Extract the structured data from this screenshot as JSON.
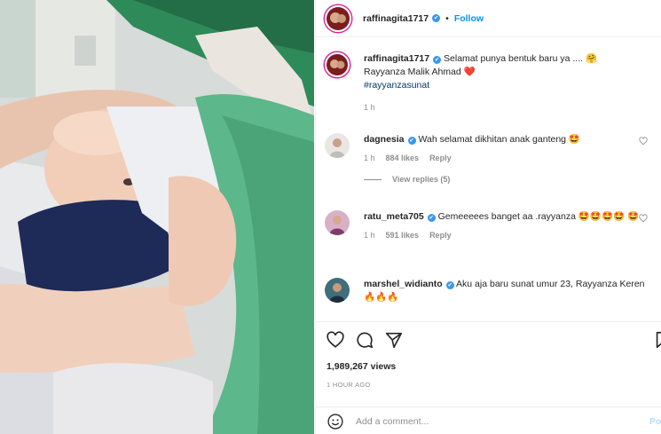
{
  "post": {
    "username": "raffinagita1717",
    "follow_label": "Follow",
    "dot": "•",
    "more_label": "···",
    "caption_line1": "Selamat punya bentuk baru ya .... 🤗",
    "caption_line2": "Rayyanza Malik Ahmad ❤️",
    "hashtag": "#rayyanzasunat",
    "caption_time": "1 h"
  },
  "comments": [
    {
      "username": "dagnesia",
      "text": "Wah selamat dikhitan anak ganteng 🤩",
      "time": "1 h",
      "likes": "884 likes",
      "reply": "Reply",
      "view_replies": "View replies (5)"
    },
    {
      "username": "ratu_meta705",
      "text": "Gemeeeees banget aa .rayyanza 🤩🤩🤩🤩 🤩",
      "time": "1 h",
      "likes": "591 likes",
      "reply": "Reply"
    },
    {
      "username": "marshel_widianto",
      "text": "Aku aja baru sunat umur 23, Rayyanza Keren🔥🔥🔥"
    }
  ],
  "stats": {
    "views": "1,989,267 views",
    "posted_ago": "1 HOUR AGO"
  },
  "composer": {
    "placeholder": "Add a comment...",
    "post_label": "Po"
  },
  "colors": {
    "accent": "#0095f6",
    "verified": "#3897f0",
    "muted": "#8e8e8e",
    "hashtag": "#00376b"
  },
  "icons": [
    "like-heart-icon",
    "comment-bubble-icon",
    "share-plane-icon",
    "save-bookmark-icon",
    "emoji-smile-icon",
    "more-options-icon",
    "verified-badge-icon"
  ]
}
